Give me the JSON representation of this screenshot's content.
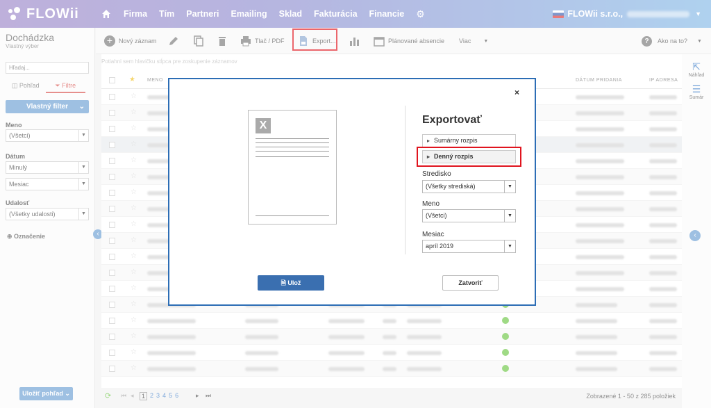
{
  "brand": {
    "name": "FLOWii"
  },
  "nav": {
    "items": [
      "Firma",
      "Tím",
      "Partneri",
      "Emailing",
      "Sklad",
      "Fakturácia",
      "Financie"
    ]
  },
  "account": {
    "company": "FLOWii s.r.o.,"
  },
  "sidebar": {
    "title": "Dochádzka",
    "subtitle": "Vlastný výber",
    "search_placeholder": "Hľadaj...",
    "tab_view": "Pohľad",
    "tab_filters": "Filtre",
    "filter_button": "Vlastný filter",
    "meno_label": "Meno",
    "meno_value": "(Všetci)",
    "datum_label": "Dátum",
    "datum_value": "Minulý",
    "datum_unit": "Mesiac",
    "udalost_label": "Udalosť",
    "udalost_value": "(Všetky udalosti)",
    "oznacenie": "Označenie",
    "save_view": "Uložiť pohľad"
  },
  "toolbar": {
    "new_record": "Nový záznam",
    "print": "Tlač / PDF",
    "export": "Export...",
    "planned": "Plánované absencie",
    "more": "Viac",
    "help": "Ako na to?"
  },
  "grid": {
    "hint": "Potiahni sem hlavičku stĺpca pre zoskupenie záznamov",
    "col_meno": "MENO",
    "col_datum": "DÁTUM PRIDANIA",
    "col_ip": "IP ADRESA",
    "row_count": 18
  },
  "pager": {
    "pages": [
      "1",
      "2",
      "3",
      "4",
      "5",
      "6"
    ],
    "summary": "Zobrazené 1 - 50 z 285 položiek"
  },
  "rail": {
    "preview": "Náhľad",
    "summary": "Sumár"
  },
  "modal": {
    "title": "Exportovať",
    "option_summary": "Sumárny rozpis",
    "option_daily": "Denný rozpis",
    "stredisko_label": "Stredisko",
    "stredisko_value": "(Všetky strediská)",
    "meno_label": "Meno",
    "meno_value": "(Všetci)",
    "mesiac_label": "Mesiac",
    "mesiac_value": "apríl 2019",
    "save_button": "Ulož",
    "close_button": "Zatvoriť"
  },
  "colors": {
    "accent": "#3a6fb0",
    "highlight": "#e0141e",
    "status_ok": "#6cc644"
  }
}
